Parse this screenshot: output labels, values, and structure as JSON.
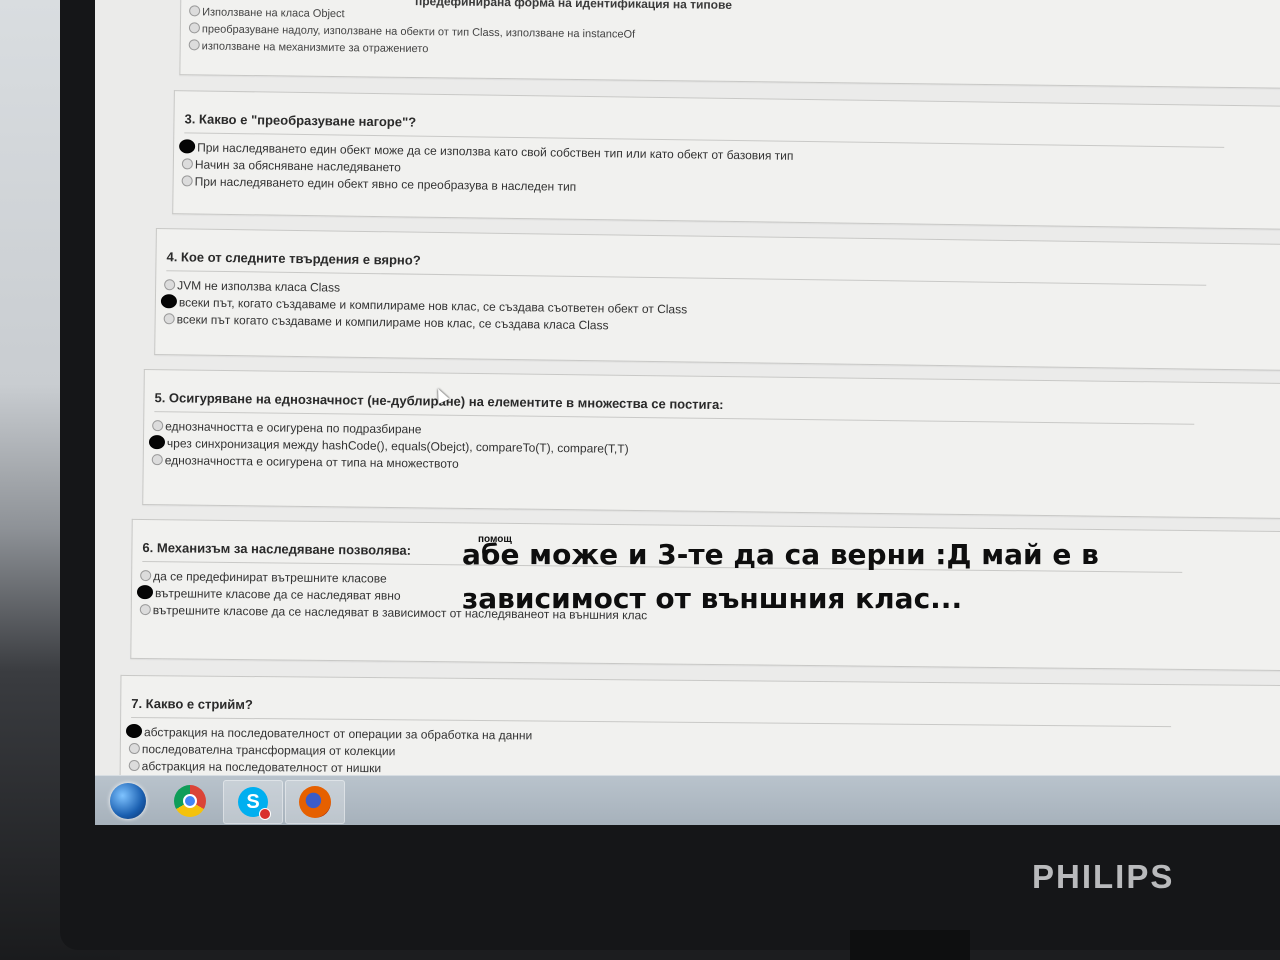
{
  "top_fragment": {
    "header": "предефинирана форма на идентификация на типове",
    "options": [
      "Използване на класа Object",
      "преобразуване надолу, използване на обекти от тип Class, използване на instanceOf",
      "използване на механизмите за отражението"
    ]
  },
  "questions": [
    {
      "title": "3. Какво е \"преобразуване нагоре\"?",
      "selected": 0,
      "options": [
        "При наследяването един обект може да се използва като свой собствен тип или като обект от базовия тип",
        "Начин за обясняване наследяването",
        "При наследяването един обект явно се преобразува в наследен тип"
      ]
    },
    {
      "title": "4. Кое от следните твърдения е вярно?",
      "selected": 1,
      "options": [
        "JVM не използва класа Class",
        "всеки път, когато създаваме и компилираме нов клас, се създава съответен обект от Class",
        "всеки път когато създаваме и компилираме нов клас, се създава класа Class"
      ]
    },
    {
      "title": "5. Осигуряване на еднозначност (не-дублиране) на елементите в множества се постига:",
      "selected": 1,
      "options": [
        "еднозначността е осигурена по подразбиране",
        "чрез синхронизация между hashCode(), equals(Obejct), compareTo(T), compare(T,T)",
        "еднозначността е осигурена от типа на множеството"
      ]
    },
    {
      "title": "6. Механизъм за наследяване позволява:",
      "selected": 1,
      "options": [
        "да се предефинират вътрешните класове",
        "вътрешните класове да се наследяват явно",
        "вътрешните класове да се наследяват в зависимост от наследяванеот на външния клас"
      ]
    },
    {
      "title": "7. Какво е стрийм?",
      "selected": 0,
      "options": [
        "абстракция на последователност от операции за обработка на данни",
        "последователна трансформация от колекции",
        "абстракция на последователност от нишки"
      ]
    }
  ],
  "overlay": {
    "help": "помощ",
    "line1": "абе може и 3-те да са верни :Д май е в",
    "line2": "зависимост от външния клас..."
  },
  "taskbar": {
    "icons": [
      "windows-start-icon",
      "chrome-icon",
      "skype-icon",
      "firefox-icon"
    ],
    "skype_letter": "S"
  },
  "monitor": {
    "brand": "PHILIPS"
  }
}
